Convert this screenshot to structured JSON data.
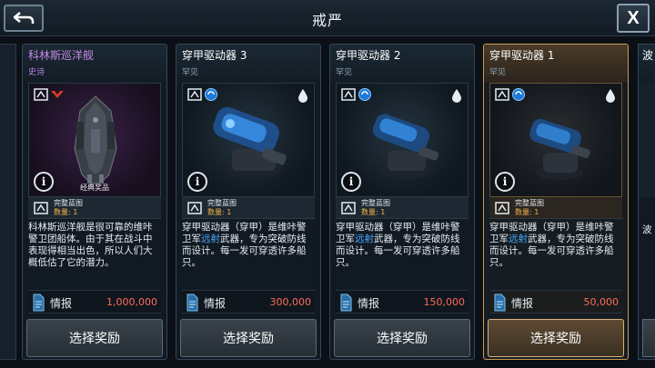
{
  "header": {
    "title": "戒严"
  },
  "cards": [
    {
      "name": "科林斯巡洋舰",
      "rarity": "史诗",
      "reward_tag": "经典奖品",
      "blueprint_label": "完整蓝图",
      "blueprint_qty": "数量: 1",
      "desc": "科林斯巡洋舰是很可靠的维咔警卫团船体。由于其在战斗中表现得相当出色，所以人们大概低估了它的潜力。",
      "cost_label": "情报",
      "cost_value": "1,000,000",
      "button": "选择奖励"
    },
    {
      "name": "穿甲驱动器 3",
      "rarity": "罕见",
      "blueprint_label": "完整蓝图",
      "blueprint_qty": "数量: 1",
      "desc_before": "穿甲驱动器（穿甲）是维咔警卫军",
      "desc_highlight": "远射",
      "desc_after": "武器，专为突破防线而设计。每一发可穿透许多船只。",
      "cost_label": "情报",
      "cost_value": "300,000",
      "button": "选择奖励"
    },
    {
      "name": "穿甲驱动器 2",
      "rarity": "罕见",
      "blueprint_label": "完整蓝图",
      "blueprint_qty": "数量: 1",
      "desc_before": "穿甲驱动器（穿甲）是维咔警卫军",
      "desc_highlight": "远射",
      "desc_after": "武器，专为突破防线而设计。每一发可穿透许多船只。",
      "cost_label": "情报",
      "cost_value": "150,000",
      "button": "选择奖励"
    },
    {
      "name": "穿甲驱动器 1",
      "rarity": "罕见",
      "blueprint_label": "完整蓝图",
      "blueprint_qty": "数量: 1",
      "desc_before": "穿甲驱动器（穿甲）是维咔警卫军",
      "desc_highlight": "远射",
      "desc_after": "武器，专为突破防线而设计。每一发可穿透许多船只。",
      "cost_label": "情报",
      "cost_value": "50,000",
      "button": "选择奖励"
    }
  ],
  "partial_card": {
    "name_fragment": "波",
    "desc_fragment": "波"
  },
  "colors": {
    "epic": "#c48ce8",
    "highlight": "#4aa8ff",
    "cost": "#ff6a5a",
    "qty": "#f0b34a",
    "selected_border": "#c99a52"
  },
  "icons": {
    "back": "back-arrow-icon",
    "close": "close-x-icon",
    "info": "info-icon",
    "blueprint": "blueprint-icon",
    "faction": "faction-emblem-icon",
    "drop": "water-drop-icon",
    "intel": "intel-file-icon"
  }
}
